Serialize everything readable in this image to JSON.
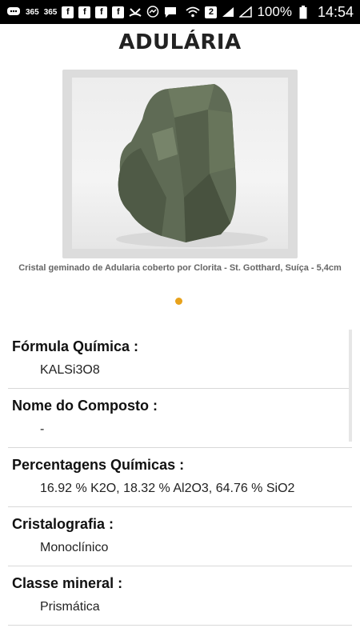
{
  "status_bar": {
    "icons": [
      "messenger-bubble-icon",
      "app-365-icon",
      "app-365-icon",
      "facebook-icon",
      "facebook-icon",
      "facebook-icon",
      "facebook-icon",
      "missed-call-icon",
      "messenger-icon",
      "message-icon"
    ],
    "badge_365": "365",
    "facebook_letter": "f",
    "sim_badge": "2",
    "battery_percent": "100%",
    "time": "14:54"
  },
  "page": {
    "title": "ADULÁRIA",
    "caption": "Cristal geminado de Adularia coberto por Clorita - St. Gotthard, Suíça - 5,4cm"
  },
  "info": [
    {
      "label": "Fórmula Química :",
      "value": "KALSi3O8"
    },
    {
      "label": "Nome do Composto :",
      "value": "-"
    },
    {
      "label": "Percentagens Químicas :",
      "value": "16.92 % K2O, 18.32 % Al2O3, 64.76 % SiO2"
    },
    {
      "label": "Cristalografia :",
      "value": "Monoclínico"
    },
    {
      "label": "Classe mineral :",
      "value": "Prismática"
    }
  ],
  "colors": {
    "accent_dot": "#e8a21b",
    "mineral": "#5f6b55"
  }
}
